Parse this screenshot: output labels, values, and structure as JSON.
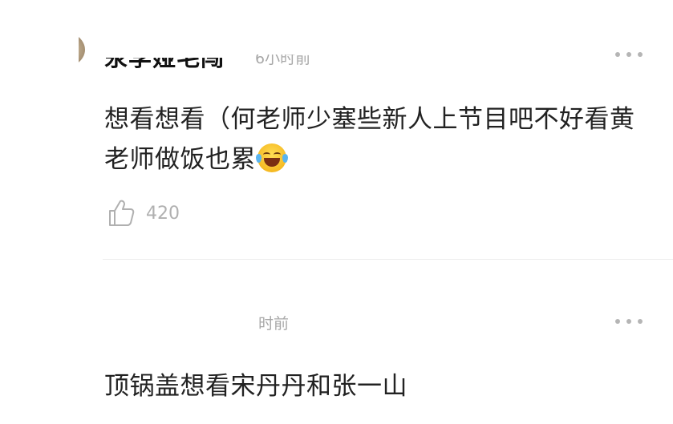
{
  "comments": [
    {
      "username": "氽李娅毛闯",
      "timestamp": "6小时前",
      "content": "想看想看（何老师少塞些新人上节目吧不好看黄老师做饭也累",
      "emoji": "face-with-tears-of-joy",
      "likes": "420",
      "more_icon": "more-dots-icon"
    },
    {
      "username": "",
      "timestamp": "时前",
      "content": "顶锅盖想看宋丹丹和张一山",
      "more_icon": "more-dots-icon"
    }
  ]
}
